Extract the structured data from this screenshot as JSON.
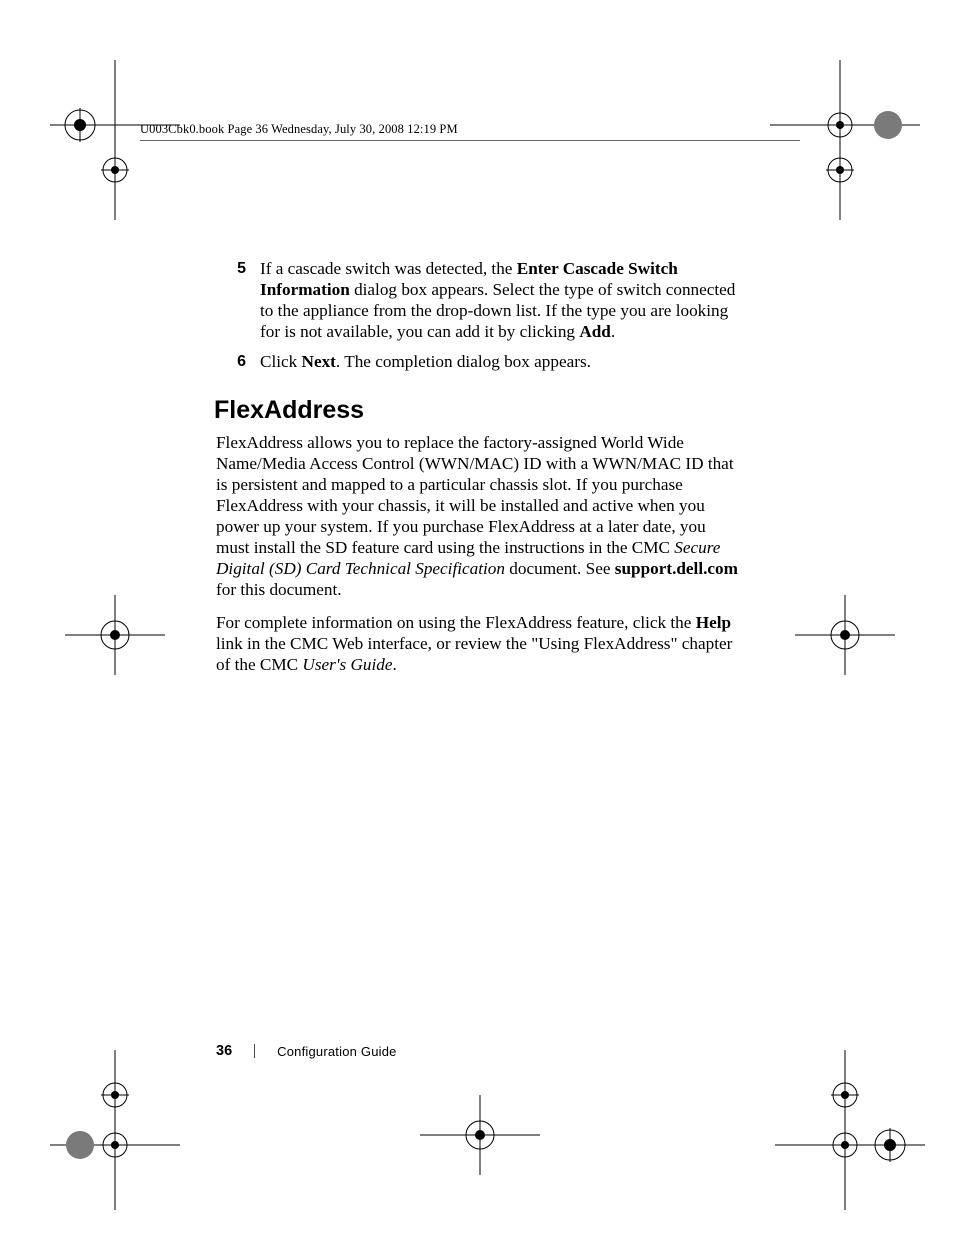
{
  "running_head": "U003Cbk0.book  Page 36  Wednesday, July 30, 2008  12:19 PM",
  "steps": [
    {
      "num": "5",
      "segments": [
        {
          "t": "If a cascade switch was detected, the "
        },
        {
          "t": "Enter Cascade Switch Information",
          "b": true
        },
        {
          "t": " dialog box appears. Select the type of switch connected to the appliance from the drop-down list. If the type you are looking for is not available, you can add it by clicking "
        },
        {
          "t": "Add",
          "b": true
        },
        {
          "t": "."
        }
      ]
    },
    {
      "num": "6",
      "segments": [
        {
          "t": "Click "
        },
        {
          "t": "Next",
          "b": true
        },
        {
          "t": ". The completion dialog box appears."
        }
      ]
    }
  ],
  "section_heading": "FlexAddress",
  "paragraphs": [
    [
      {
        "t": "FlexAddress allows you to replace the factory-assigned World Wide Name/Media Access Control (WWN/MAC) ID with a WWN/MAC ID that is persistent and mapped to a particular chassis slot. If you purchase FlexAddress with your chassis, it will be installed and active when you power up your system. If you purchase FlexAddress at a later date, you must install the SD feature card using the instructions in the CMC "
      },
      {
        "t": "Secure Digital (SD) Card Technical Specification",
        "i": true
      },
      {
        "t": " document. See "
      },
      {
        "t": "support.dell.com",
        "b": true
      },
      {
        "t": " for this document."
      }
    ],
    [
      {
        "t": "For complete information on using the FlexAddress feature, click the "
      },
      {
        "t": "Help",
        "b": true
      },
      {
        "t": " link in the CMC Web interface, or review the \"Using FlexAddress\" chapter of the CMC "
      },
      {
        "t": "User's Guide",
        "i": true
      },
      {
        "t": "."
      }
    ]
  ],
  "footer": {
    "page_number": "36",
    "doc_title": "Configuration Guide"
  }
}
